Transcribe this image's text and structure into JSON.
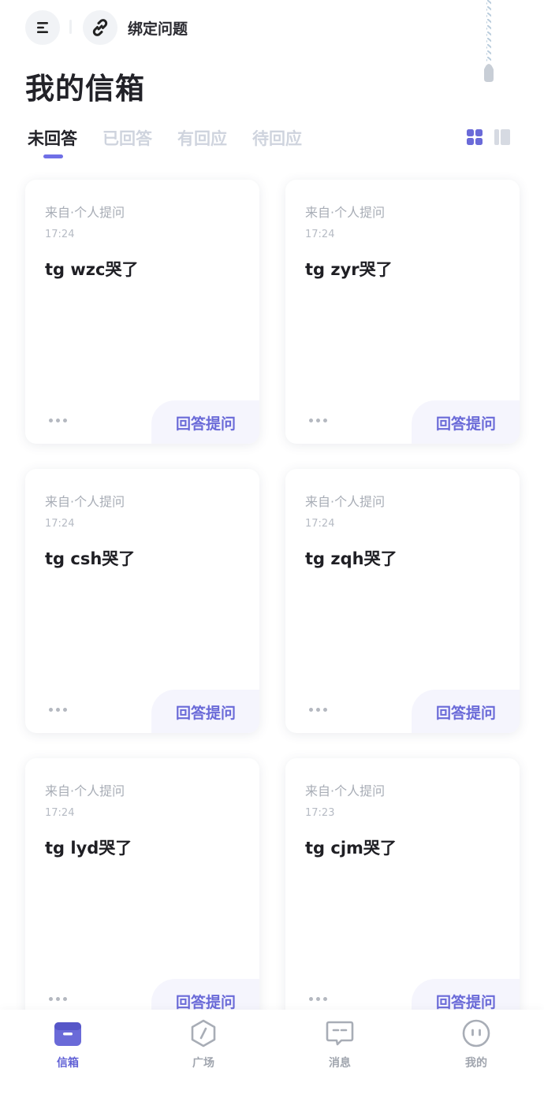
{
  "header": {
    "bind_label": "绑定问题",
    "page_title": "我的信箱"
  },
  "tabs": [
    {
      "label": "未回答",
      "active": true
    },
    {
      "label": "已回答",
      "active": false
    },
    {
      "label": "有回应",
      "active": false
    },
    {
      "label": "待回应",
      "active": false
    }
  ],
  "view_toggle": {
    "selected": "grid"
  },
  "cards": [
    {
      "source": "来自·个人提问",
      "time": "17:24",
      "question": "tg wzc哭了",
      "more_icon": "more-dots-icon",
      "answer_label": "回答提问"
    },
    {
      "source": "来自·个人提问",
      "time": "17:24",
      "question": "tg zyr哭了",
      "more_icon": "more-dots-icon",
      "answer_label": "回答提问"
    },
    {
      "source": "来自·个人提问",
      "time": "17:24",
      "question": "tg csh哭了",
      "more_icon": "more-dots-icon",
      "answer_label": "回答提问"
    },
    {
      "source": "来自·个人提问",
      "time": "17:24",
      "question": "tg zqh哭了",
      "more_icon": "more-dots-icon",
      "answer_label": "回答提问"
    },
    {
      "source": "来自·个人提问",
      "time": "17:24",
      "question": "tg lyd哭了",
      "more_icon": "more-dots-icon",
      "answer_label": "回答提问"
    },
    {
      "source": "来自·个人提问",
      "time": "17:23",
      "question": "tg cjm哭了",
      "more_icon": "more-dots-icon",
      "answer_label": "回答提问"
    }
  ],
  "bottom_nav": [
    {
      "label": "信箱",
      "icon": "mailbox-icon",
      "active": true
    },
    {
      "label": "广场",
      "icon": "compass-icon",
      "active": false
    },
    {
      "label": "消息",
      "icon": "message-icon",
      "active": false
    },
    {
      "label": "我的",
      "icon": "profile-face-icon",
      "active": false
    }
  ],
  "colors": {
    "accent": "#6a6ad8",
    "tab_inactive": "#cfd4de",
    "answer_bg": "#f5f5fd"
  }
}
